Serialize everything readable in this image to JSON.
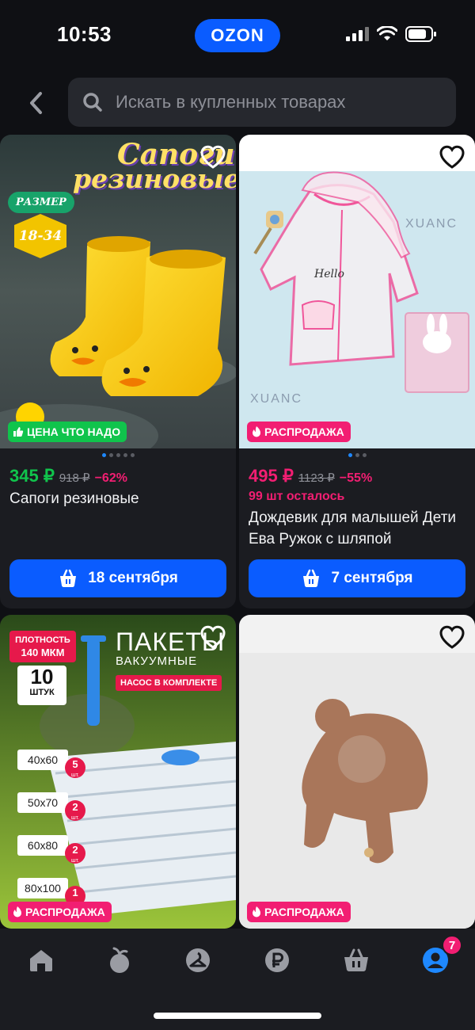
{
  "status_bar": {
    "time": "10:53",
    "brand": "OZON"
  },
  "search": {
    "placeholder": "Искать в купленных товарах"
  },
  "products": [
    {
      "image_text": {
        "headline_1": "Сапоги",
        "headline_2": "резиновые",
        "size_label": "РАЗМЕР",
        "size_range": "18-34"
      },
      "badge": "ЦЕНА ЧТО НАДО",
      "price": "345 ₽",
      "old_price": "918 ₽",
      "discount": "−62%",
      "stock": "",
      "title": "Сапоги резиновые",
      "delivery": "18 сентября"
    },
    {
      "image_text": {
        "watermark": "XUANC",
        "hello": "Hello"
      },
      "badge": "РАСПРОДАЖА",
      "price": "495 ₽",
      "old_price": "1123 ₽",
      "discount": "−55%",
      "stock": "99 шт осталось",
      "title": "Дождевик для малышей Дети Ева Ружок с шляпой",
      "delivery": "7 сентября"
    },
    {
      "image_text": {
        "density_1": "ПЛОТНОСТЬ",
        "density_2": "140 МКМ",
        "count": "10",
        "count_unit": "ШТУК",
        "headline_1": "ПАКЕТЫ",
        "headline_2": "ВАКУУМНЫЕ",
        "pump": "НАСОС В КОМПЛЕКТЕ",
        "sizes": [
          {
            "size": "40x60",
            "qty": "5"
          },
          {
            "size": "50x70",
            "qty": "2"
          },
          {
            "size": "60x80",
            "qty": "2"
          },
          {
            "size": "80x100",
            "qty": "1"
          }
        ],
        "qty_unit": "шт."
      },
      "badge": "РАСПРОДАЖА"
    },
    {
      "badge": "РАСПРОДАЖА"
    }
  ],
  "tabbar": {
    "cart_count": "7",
    "icons": [
      "home-icon",
      "fresh-icon",
      "favorites-icon",
      "ruble-icon",
      "cart-icon",
      "profile-icon"
    ]
  },
  "colors": {
    "accent": "#0a5cff",
    "green": "#10c44c",
    "pink": "#f21e72",
    "background": "#0f1014",
    "card": "#1b1c21"
  }
}
